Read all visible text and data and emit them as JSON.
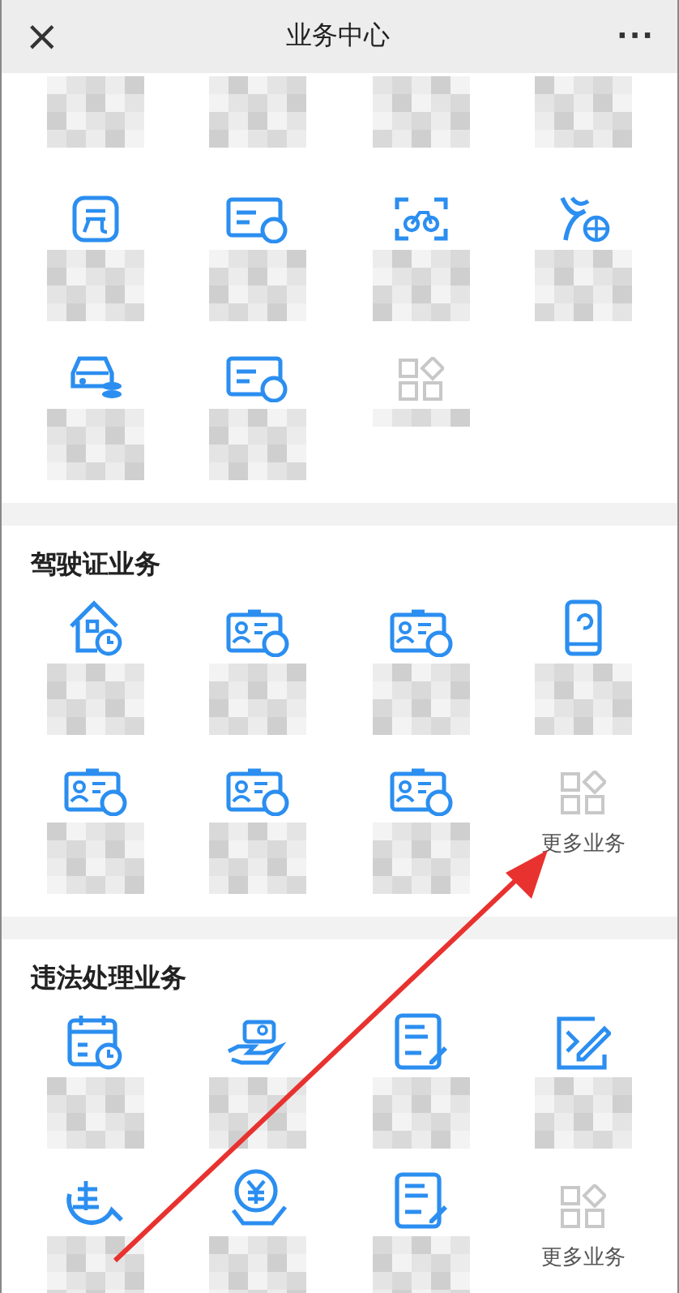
{
  "header": {
    "close": "×",
    "title": "业务中心",
    "menu": "···"
  },
  "sections": [
    {
      "items": [
        {
          "kind": "label_only"
        },
        {
          "kind": "label_only"
        },
        {
          "kind": "label_only"
        },
        {
          "kind": "label_only"
        },
        {
          "kind": "service"
        },
        {
          "kind": "service"
        },
        {
          "kind": "service"
        },
        {
          "kind": "service"
        },
        {
          "kind": "service"
        },
        {
          "kind": "service"
        },
        {
          "kind": "more_hidden"
        }
      ]
    },
    {
      "title": "驾驶证业务",
      "items": [
        {
          "kind": "service"
        },
        {
          "kind": "service"
        },
        {
          "kind": "service"
        },
        {
          "kind": "service"
        },
        {
          "kind": "service"
        },
        {
          "kind": "service"
        },
        {
          "kind": "service"
        },
        {
          "kind": "more",
          "label": "更多业务"
        }
      ]
    },
    {
      "title": "违法处理业务",
      "items": [
        {
          "kind": "service"
        },
        {
          "kind": "service"
        },
        {
          "kind": "service"
        },
        {
          "kind": "service"
        },
        {
          "kind": "service"
        },
        {
          "kind": "service"
        },
        {
          "kind": "service"
        },
        {
          "kind": "more",
          "label": "更多业务"
        }
      ]
    }
  ]
}
